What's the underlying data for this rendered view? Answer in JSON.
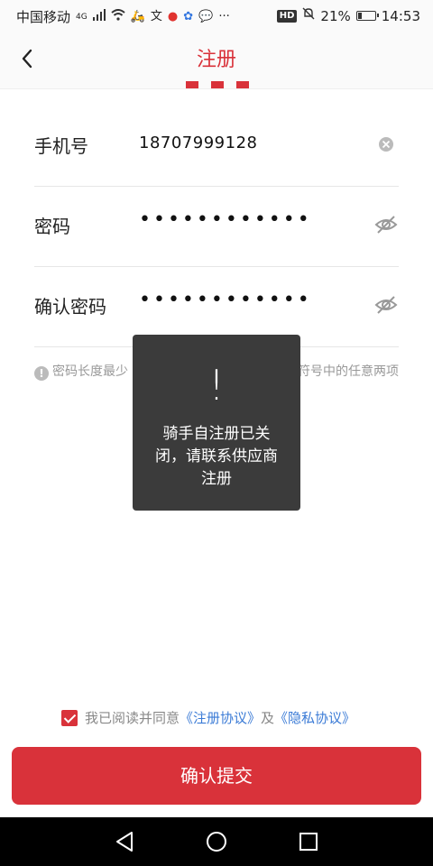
{
  "status_bar": {
    "carrier": "中国移动",
    "network": "4G",
    "icons": [
      "signal-icon",
      "wifi-icon",
      "delivery-app-icon",
      "app-icon",
      "location-icon",
      "paw-icon",
      "message-icon",
      "more-icon"
    ],
    "hd_label": "HD",
    "battery": "21%",
    "battery_level": 0.21,
    "time": "14:53"
  },
  "header": {
    "title": "注册",
    "accent_color": "#d9323a"
  },
  "form": {
    "phone": {
      "label": "手机号",
      "value": "18707999128"
    },
    "password": {
      "label": "密码",
      "value": "••••••••••••"
    },
    "confirm_password": {
      "label": "确认密码",
      "value": "••••••••••••"
    }
  },
  "hint": {
    "text_start": "密码长度最少",
    "text_end": "、符号中的任意两项"
  },
  "toast": {
    "icon": "!",
    "message": "骑手自注册已关闭，请联系供应商注册"
  },
  "agreement": {
    "checked": true,
    "prefix": "我已阅读并同意",
    "register_link": "《注册协议》",
    "and": "及",
    "privacy_link": "《隐私协议》"
  },
  "submit_label": "确认提交"
}
